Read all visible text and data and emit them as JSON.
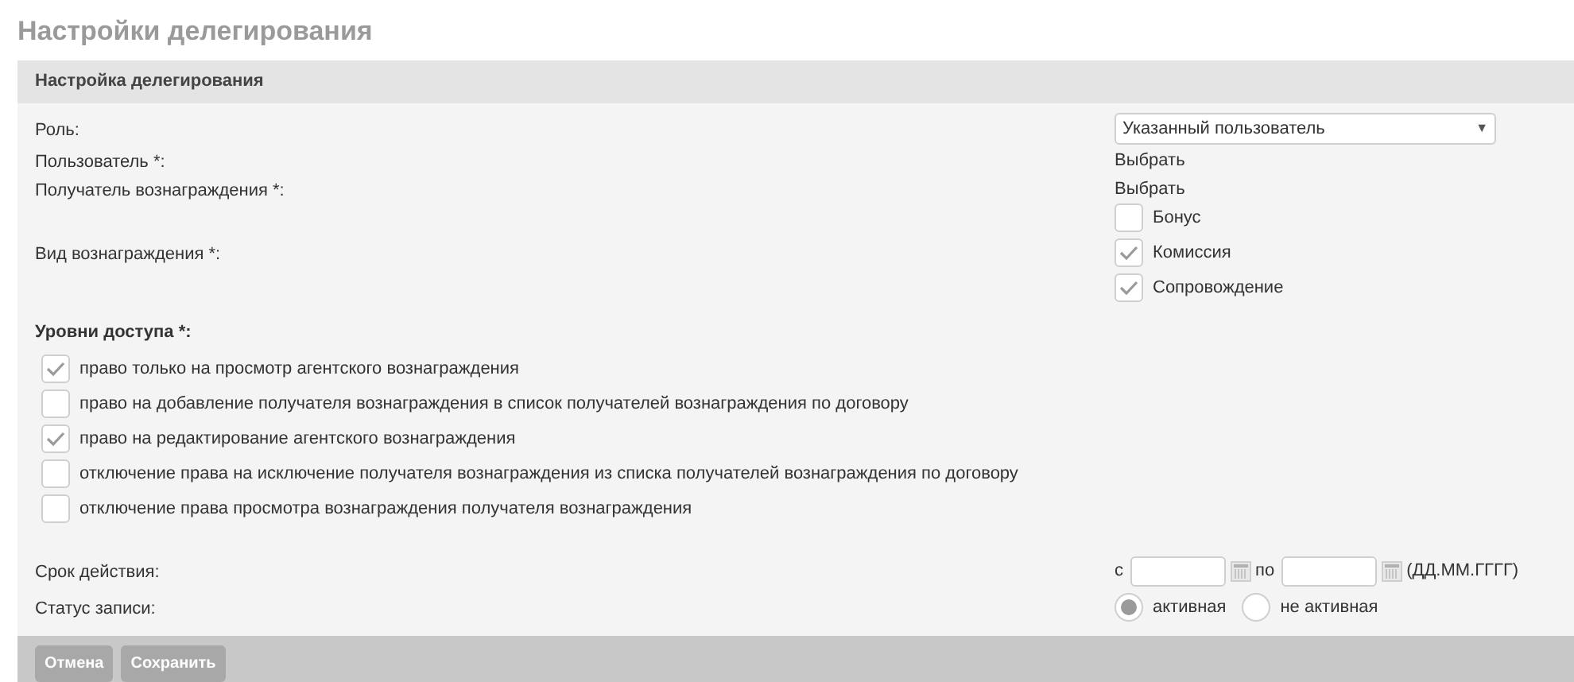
{
  "page_title": "Настройки делегирования",
  "panel": {
    "title": "Настройка делегирования"
  },
  "role": {
    "label": "Роль:",
    "value": "Указанный пользователь",
    "arrow": "▼"
  },
  "user": {
    "label": "Пользователь *:",
    "link": "Выбрать"
  },
  "recipient": {
    "label": "Получатель вознаграждения *:",
    "link": "Выбрать"
  },
  "reward_type": {
    "label": "Вид вознаграждения *:",
    "options": [
      {
        "label": "Бонус",
        "checked": false
      },
      {
        "label": "Комиссия",
        "checked": true
      },
      {
        "label": "Сопровождение",
        "checked": true
      }
    ]
  },
  "access_levels": {
    "label": "Уровни доступа *:",
    "items": [
      {
        "label": "право только на просмотр агентского вознаграждения",
        "checked": true
      },
      {
        "label": "право на добавление получателя вознаграждения в список получателей вознаграждения по договору",
        "checked": false
      },
      {
        "label": "право на редактирование агентского вознаграждения",
        "checked": true
      },
      {
        "label": "отключение права на исключение получателя вознаграждения из списка получателей вознаграждения по договору",
        "checked": false
      },
      {
        "label": "отключение права просмотра вознаграждения получателя вознаграждения",
        "checked": false
      }
    ]
  },
  "validity": {
    "label": "Срок действия:",
    "from_label": "с",
    "to_label": "по",
    "format_hint": "(ДД.ММ.ГГГГ)"
  },
  "status": {
    "label": "Статус записи:",
    "options": [
      {
        "label": "активная",
        "selected": true
      },
      {
        "label": "не активная",
        "selected": false
      }
    ]
  },
  "buttons": [
    "Отмена",
    "Сохранить"
  ]
}
